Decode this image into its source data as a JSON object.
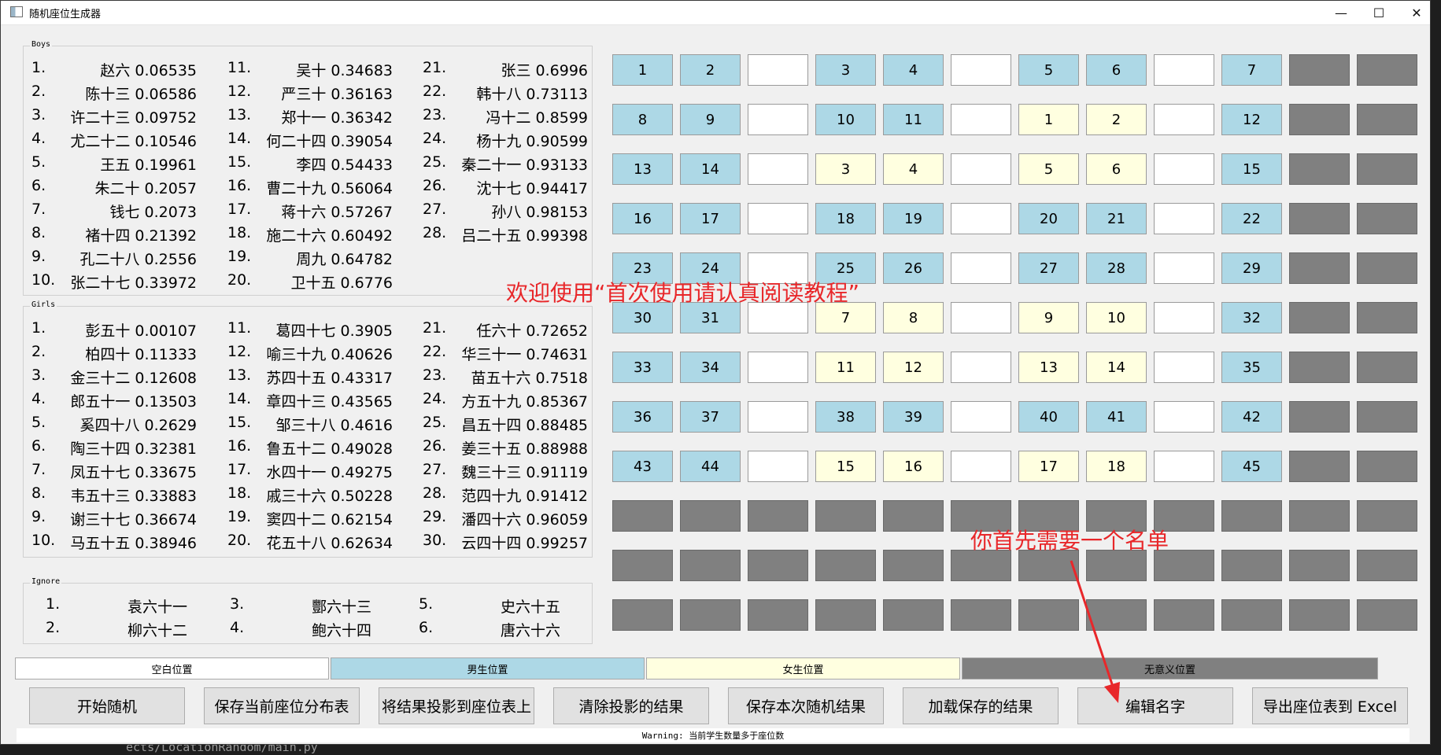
{
  "window": {
    "title": "随机座位生成器",
    "controls": [
      "—",
      "☐",
      "✕"
    ]
  },
  "backdrop": {
    "path_text": "ects/LocationRandom/main.py"
  },
  "boys": {
    "label": "Boys",
    "entries": [
      {
        "n": "1.",
        "name": "赵六",
        "score": "0.06535"
      },
      {
        "n": "2.",
        "name": "陈十三",
        "score": "0.06586"
      },
      {
        "n": "3.",
        "name": "许二十三",
        "score": "0.09752"
      },
      {
        "n": "4.",
        "name": "尤二十二",
        "score": "0.10546"
      },
      {
        "n": "5.",
        "name": "王五",
        "score": "0.19961"
      },
      {
        "n": "6.",
        "name": "朱二十",
        "score": "0.2057"
      },
      {
        "n": "7.",
        "name": "钱七",
        "score": "0.2073"
      },
      {
        "n": "8.",
        "name": "褚十四",
        "score": "0.21392"
      },
      {
        "n": "9.",
        "name": "孔二十八",
        "score": "0.2556"
      },
      {
        "n": "10.",
        "name": "张二十七",
        "score": "0.33972"
      },
      {
        "n": "11.",
        "name": "吴十",
        "score": "0.34683"
      },
      {
        "n": "12.",
        "name": "严三十",
        "score": "0.36163"
      },
      {
        "n": "13.",
        "name": "郑十一",
        "score": "0.36342"
      },
      {
        "n": "14.",
        "name": "何二十四",
        "score": "0.39054"
      },
      {
        "n": "15.",
        "name": "李四",
        "score": "0.54433"
      },
      {
        "n": "16.",
        "name": "曹二十九",
        "score": "0.56064"
      },
      {
        "n": "17.",
        "name": "蒋十六",
        "score": "0.57267"
      },
      {
        "n": "18.",
        "name": "施二十六",
        "score": "0.60492"
      },
      {
        "n": "19.",
        "name": "周九",
        "score": "0.64782"
      },
      {
        "n": "20.",
        "name": "卫十五",
        "score": "0.6776"
      },
      {
        "n": "21.",
        "name": "张三",
        "score": "0.6996"
      },
      {
        "n": "22.",
        "name": "韩十八",
        "score": "0.73113"
      },
      {
        "n": "23.",
        "name": "冯十二",
        "score": "0.8599"
      },
      {
        "n": "24.",
        "name": "杨十九",
        "score": "0.90599"
      },
      {
        "n": "25.",
        "name": "秦二十一",
        "score": "0.93133"
      },
      {
        "n": "26.",
        "name": "沈十七",
        "score": "0.94417"
      },
      {
        "n": "27.",
        "name": "孙八",
        "score": "0.98153"
      },
      {
        "n": "28.",
        "name": "吕二十五",
        "score": "0.99398"
      }
    ]
  },
  "girls": {
    "label": "Girls",
    "entries": [
      {
        "n": "1.",
        "name": "彭五十",
        "score": "0.00107"
      },
      {
        "n": "2.",
        "name": "柏四十",
        "score": "0.11333"
      },
      {
        "n": "3.",
        "name": "金三十二",
        "score": "0.12608"
      },
      {
        "n": "4.",
        "name": "郎五十一",
        "score": "0.13503"
      },
      {
        "n": "5.",
        "name": "奚四十八",
        "score": "0.2629"
      },
      {
        "n": "6.",
        "name": "陶三十四",
        "score": "0.32381"
      },
      {
        "n": "7.",
        "name": "凤五十七",
        "score": "0.33675"
      },
      {
        "n": "8.",
        "name": "韦五十三",
        "score": "0.33883"
      },
      {
        "n": "9.",
        "name": "谢三十七",
        "score": "0.36674"
      },
      {
        "n": "10.",
        "name": "马五十五",
        "score": "0.38946"
      },
      {
        "n": "11.",
        "name": "葛四十七",
        "score": "0.3905"
      },
      {
        "n": "12.",
        "name": "喻三十九",
        "score": "0.40626"
      },
      {
        "n": "13.",
        "name": "苏四十五",
        "score": "0.43317"
      },
      {
        "n": "14.",
        "name": "章四十三",
        "score": "0.43565"
      },
      {
        "n": "15.",
        "name": "邹三十八",
        "score": "0.4616"
      },
      {
        "n": "16.",
        "name": "鲁五十二",
        "score": "0.49028"
      },
      {
        "n": "17.",
        "name": "水四十一",
        "score": "0.49275"
      },
      {
        "n": "18.",
        "name": "戚三十六",
        "score": "0.50228"
      },
      {
        "n": "19.",
        "name": "窦四十二",
        "score": "0.62154"
      },
      {
        "n": "20.",
        "name": "花五十八",
        "score": "0.62634"
      },
      {
        "n": "21.",
        "name": "任六十",
        "score": "0.72652"
      },
      {
        "n": "22.",
        "name": "华三十一",
        "score": "0.74631"
      },
      {
        "n": "23.",
        "name": "苗五十六",
        "score": "0.7518"
      },
      {
        "n": "24.",
        "name": "方五十九",
        "score": "0.85367"
      },
      {
        "n": "25.",
        "name": "昌五十四",
        "score": "0.88485"
      },
      {
        "n": "26.",
        "name": "姜三十五",
        "score": "0.88988"
      },
      {
        "n": "27.",
        "name": "魏三十三",
        "score": "0.91119"
      },
      {
        "n": "28.",
        "name": "范四十九",
        "score": "0.91412"
      },
      {
        "n": "29.",
        "name": "潘四十六",
        "score": "0.96059"
      },
      {
        "n": "30.",
        "name": "云四十四",
        "score": "0.99257"
      }
    ]
  },
  "ignore": {
    "label": "Ignore",
    "entries": [
      {
        "n": "1.",
        "name": "袁六十一"
      },
      {
        "n": "2.",
        "name": "柳六十二"
      },
      {
        "n": "3.",
        "name": "酆六十三"
      },
      {
        "n": "4.",
        "name": "鲍六十四"
      },
      {
        "n": "5.",
        "name": "史六十五"
      },
      {
        "n": "6.",
        "name": "唐六十六"
      }
    ]
  },
  "seat_types": [
    "empty",
    "boy",
    "girl",
    "void"
  ],
  "seat_grid": [
    [
      {
        "t": "boy",
        "v": "1"
      },
      {
        "t": "boy",
        "v": "2"
      },
      {
        "t": "empty",
        "v": ""
      },
      {
        "t": "boy",
        "v": "3"
      },
      {
        "t": "boy",
        "v": "4"
      },
      {
        "t": "empty",
        "v": ""
      },
      {
        "t": "boy",
        "v": "5"
      },
      {
        "t": "boy",
        "v": "6"
      },
      {
        "t": "empty",
        "v": ""
      },
      {
        "t": "boy",
        "v": "7"
      },
      {
        "t": "void",
        "v": ""
      },
      {
        "t": "void",
        "v": ""
      }
    ],
    [
      {
        "t": "boy",
        "v": "8"
      },
      {
        "t": "boy",
        "v": "9"
      },
      {
        "t": "empty",
        "v": ""
      },
      {
        "t": "boy",
        "v": "10"
      },
      {
        "t": "boy",
        "v": "11"
      },
      {
        "t": "empty",
        "v": ""
      },
      {
        "t": "girl",
        "v": "1"
      },
      {
        "t": "girl",
        "v": "2"
      },
      {
        "t": "empty",
        "v": ""
      },
      {
        "t": "boy",
        "v": "12"
      },
      {
        "t": "void",
        "v": ""
      },
      {
        "t": "void",
        "v": ""
      }
    ],
    [
      {
        "t": "boy",
        "v": "13"
      },
      {
        "t": "boy",
        "v": "14"
      },
      {
        "t": "empty",
        "v": ""
      },
      {
        "t": "girl",
        "v": "3"
      },
      {
        "t": "girl",
        "v": "4"
      },
      {
        "t": "empty",
        "v": ""
      },
      {
        "t": "girl",
        "v": "5"
      },
      {
        "t": "girl",
        "v": "6"
      },
      {
        "t": "empty",
        "v": ""
      },
      {
        "t": "boy",
        "v": "15"
      },
      {
        "t": "void",
        "v": ""
      },
      {
        "t": "void",
        "v": ""
      }
    ],
    [
      {
        "t": "boy",
        "v": "16"
      },
      {
        "t": "boy",
        "v": "17"
      },
      {
        "t": "empty",
        "v": ""
      },
      {
        "t": "boy",
        "v": "18"
      },
      {
        "t": "boy",
        "v": "19"
      },
      {
        "t": "empty",
        "v": ""
      },
      {
        "t": "boy",
        "v": "20"
      },
      {
        "t": "boy",
        "v": "21"
      },
      {
        "t": "empty",
        "v": ""
      },
      {
        "t": "boy",
        "v": "22"
      },
      {
        "t": "void",
        "v": ""
      },
      {
        "t": "void",
        "v": ""
      }
    ],
    [
      {
        "t": "boy",
        "v": "23"
      },
      {
        "t": "boy",
        "v": "24"
      },
      {
        "t": "empty",
        "v": ""
      },
      {
        "t": "boy",
        "v": "25"
      },
      {
        "t": "boy",
        "v": "26"
      },
      {
        "t": "empty",
        "v": ""
      },
      {
        "t": "boy",
        "v": "27"
      },
      {
        "t": "boy",
        "v": "28"
      },
      {
        "t": "empty",
        "v": ""
      },
      {
        "t": "boy",
        "v": "29"
      },
      {
        "t": "void",
        "v": ""
      },
      {
        "t": "void",
        "v": ""
      }
    ],
    [
      {
        "t": "boy",
        "v": "30"
      },
      {
        "t": "boy",
        "v": "31"
      },
      {
        "t": "empty",
        "v": ""
      },
      {
        "t": "girl",
        "v": "7"
      },
      {
        "t": "girl",
        "v": "8"
      },
      {
        "t": "empty",
        "v": ""
      },
      {
        "t": "girl",
        "v": "9"
      },
      {
        "t": "girl",
        "v": "10"
      },
      {
        "t": "empty",
        "v": ""
      },
      {
        "t": "boy",
        "v": "32"
      },
      {
        "t": "void",
        "v": ""
      },
      {
        "t": "void",
        "v": ""
      }
    ],
    [
      {
        "t": "boy",
        "v": "33"
      },
      {
        "t": "boy",
        "v": "34"
      },
      {
        "t": "empty",
        "v": ""
      },
      {
        "t": "girl",
        "v": "11"
      },
      {
        "t": "girl",
        "v": "12"
      },
      {
        "t": "empty",
        "v": ""
      },
      {
        "t": "girl",
        "v": "13"
      },
      {
        "t": "girl",
        "v": "14"
      },
      {
        "t": "empty",
        "v": ""
      },
      {
        "t": "boy",
        "v": "35"
      },
      {
        "t": "void",
        "v": ""
      },
      {
        "t": "void",
        "v": ""
      }
    ],
    [
      {
        "t": "boy",
        "v": "36"
      },
      {
        "t": "boy",
        "v": "37"
      },
      {
        "t": "empty",
        "v": ""
      },
      {
        "t": "boy",
        "v": "38"
      },
      {
        "t": "boy",
        "v": "39"
      },
      {
        "t": "empty",
        "v": ""
      },
      {
        "t": "boy",
        "v": "40"
      },
      {
        "t": "boy",
        "v": "41"
      },
      {
        "t": "empty",
        "v": ""
      },
      {
        "t": "boy",
        "v": "42"
      },
      {
        "t": "void",
        "v": ""
      },
      {
        "t": "void",
        "v": ""
      }
    ],
    [
      {
        "t": "boy",
        "v": "43"
      },
      {
        "t": "boy",
        "v": "44"
      },
      {
        "t": "empty",
        "v": ""
      },
      {
        "t": "girl",
        "v": "15"
      },
      {
        "t": "girl",
        "v": "16"
      },
      {
        "t": "empty",
        "v": ""
      },
      {
        "t": "girl",
        "v": "17"
      },
      {
        "t": "girl",
        "v": "18"
      },
      {
        "t": "empty",
        "v": ""
      },
      {
        "t": "boy",
        "v": "45"
      },
      {
        "t": "void",
        "v": ""
      },
      {
        "t": "void",
        "v": ""
      }
    ],
    [
      {
        "t": "void",
        "v": ""
      },
      {
        "t": "void",
        "v": ""
      },
      {
        "t": "void",
        "v": ""
      },
      {
        "t": "void",
        "v": ""
      },
      {
        "t": "void",
        "v": ""
      },
      {
        "t": "void",
        "v": ""
      },
      {
        "t": "void",
        "v": ""
      },
      {
        "t": "void",
        "v": ""
      },
      {
        "t": "void",
        "v": ""
      },
      {
        "t": "void",
        "v": ""
      },
      {
        "t": "void",
        "v": ""
      },
      {
        "t": "void",
        "v": ""
      }
    ],
    [
      {
        "t": "void",
        "v": ""
      },
      {
        "t": "void",
        "v": ""
      },
      {
        "t": "void",
        "v": ""
      },
      {
        "t": "void",
        "v": ""
      },
      {
        "t": "void",
        "v": ""
      },
      {
        "t": "void",
        "v": ""
      },
      {
        "t": "void",
        "v": ""
      },
      {
        "t": "void",
        "v": ""
      },
      {
        "t": "void",
        "v": ""
      },
      {
        "t": "void",
        "v": ""
      },
      {
        "t": "void",
        "v": ""
      },
      {
        "t": "void",
        "v": ""
      }
    ],
    [
      {
        "t": "void",
        "v": ""
      },
      {
        "t": "void",
        "v": ""
      },
      {
        "t": "void",
        "v": ""
      },
      {
        "t": "void",
        "v": ""
      },
      {
        "t": "void",
        "v": ""
      },
      {
        "t": "void",
        "v": ""
      },
      {
        "t": "void",
        "v": ""
      },
      {
        "t": "void",
        "v": ""
      },
      {
        "t": "void",
        "v": ""
      },
      {
        "t": "void",
        "v": ""
      },
      {
        "t": "void",
        "v": ""
      },
      {
        "t": "void",
        "v": ""
      }
    ]
  ],
  "legend": [
    {
      "label": "空白位置",
      "type": "empty"
    },
    {
      "label": "男生位置",
      "type": "boy"
    },
    {
      "label": "女生位置",
      "type": "girl"
    },
    {
      "label": "无意义位置",
      "type": "void"
    }
  ],
  "buttons": [
    {
      "label": "开始随机"
    },
    {
      "label": "保存当前座位分布表"
    },
    {
      "label": "将结果投影到座位表上"
    },
    {
      "label": "清除投影的结果"
    },
    {
      "label": "保存本次随机结果"
    },
    {
      "label": "加载保存的结果"
    },
    {
      "label": "编辑名字"
    },
    {
      "label": "导出座位表到 Excel"
    }
  ],
  "status": "Warning: 当前学生数量多于座位数",
  "annotations": {
    "welcome": "欢迎使用“首次使用请认真阅读教程”",
    "hint": "你首先需要一个名单"
  },
  "colors": {
    "boy": "#add8e6",
    "girl": "#ffffe0",
    "empty": "#ffffff",
    "void": "#808080",
    "annotation": "#e8272a"
  }
}
